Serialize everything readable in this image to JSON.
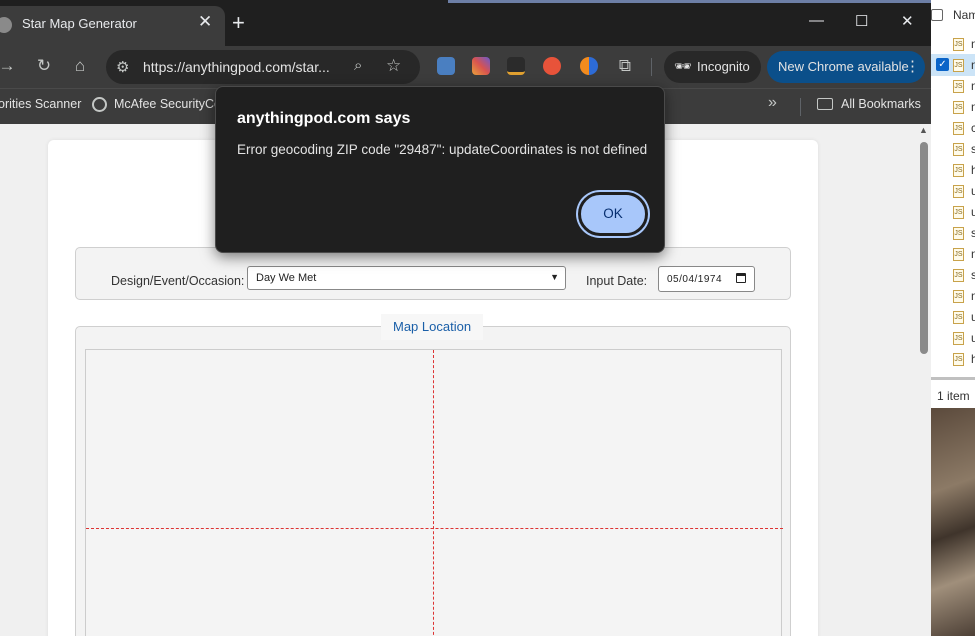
{
  "browser": {
    "tab_title": "Star Map Generator",
    "url": "https://anythingpod.com/star...",
    "incognito_label": "Incognito",
    "update_label": "New Chrome available",
    "icons": {
      "tab_close": "close-icon",
      "new_tab": "plus-icon",
      "minimize": "minimize-icon",
      "maximize": "maximize-icon",
      "close_window": "close-icon",
      "forward": "arrow-right-icon",
      "reload": "reload-icon",
      "home": "home-icon",
      "site_info": "tune-icon",
      "zoom": "zoom-icon",
      "bookmark": "star-icon",
      "extensions": "puzzle-icon",
      "menu": "more-vert-icon"
    },
    "glyphs": {
      "close": "✕",
      "plus": "+",
      "minimize": "—",
      "maximize": "☐",
      "forward": "→",
      "reload": "↻",
      "home": "⌂",
      "tune": "⚙",
      "zoom": "⌕",
      "star": "☆",
      "puzzle": "⧉",
      "incognito": "🕶",
      "more": "⋮",
      "chevrons": "»"
    }
  },
  "bookmarks": {
    "item1": "orities Scanner",
    "item2": "McAfee SecurityCen",
    "all": "All Bookmarks"
  },
  "page": {
    "design_label": "Design/Event/Occasion:",
    "design_value": "Day We Met",
    "date_label": "Input Date:",
    "date_value": "05/04/1974",
    "map_legend": "Map Location",
    "colors": {
      "accent": "#1a5fa8",
      "crosshair": "#dd3333"
    }
  },
  "dialog": {
    "title": "anythingpod.com says",
    "message": "Error geocoding ZIP code \"29487\": updateCoordinates is not defined",
    "ok_label": "OK",
    "colors": {
      "button": "#a8c7fa",
      "background": "#1f1f1f"
    }
  },
  "side_panel": {
    "header": "Nam",
    "rows": [
      "n",
      "n",
      "n",
      "n",
      "c",
      "s",
      "h",
      "u",
      "u",
      "s",
      "n",
      "s",
      "n",
      "u",
      "u",
      "h"
    ],
    "status": "1 item"
  }
}
